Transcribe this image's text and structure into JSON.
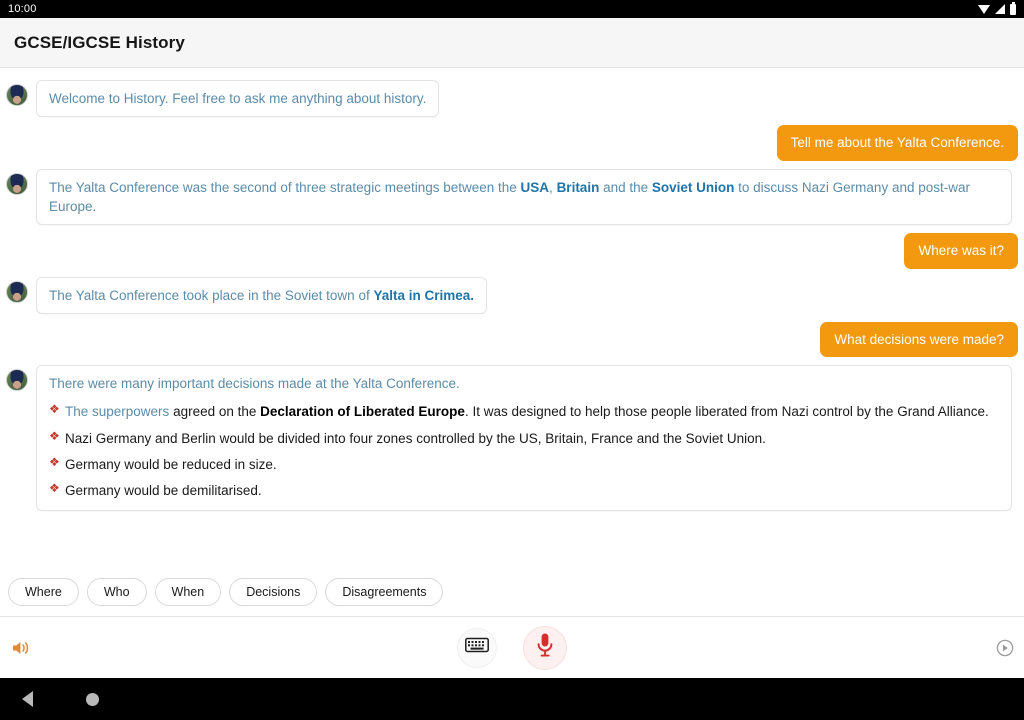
{
  "statusbar": {
    "time": "10:00",
    "icons": [
      "wifi-icon",
      "signal-icon",
      "battery-icon"
    ]
  },
  "header": {
    "title": "GCSE/IGCSE History"
  },
  "colors": {
    "user_bubble": "#f2990f",
    "bot_text": "#5b8caa",
    "bot_bold": "#1f74a8",
    "bullet": "#c0392b",
    "mic": "#d32f2f",
    "speaker": "#e08a3c"
  },
  "conversation": [
    {
      "role": "bot",
      "width": "auto",
      "text": "Welcome to History. Feel free to ask me anything about history."
    },
    {
      "role": "user",
      "text": "Tell me about the Yalta Conference."
    },
    {
      "role": "bot",
      "width": "full",
      "rich": true,
      "segments": [
        {
          "text": "The Yalta Conference was the second of three strategic meetings between the ",
          "bold": false
        },
        {
          "text": "USA",
          "bold": true
        },
        {
          "text": ", ",
          "bold": false
        },
        {
          "text": "Britain",
          "bold": true
        },
        {
          "text": " and the ",
          "bold": false
        },
        {
          "text": "Soviet Union",
          "bold": true
        },
        {
          "text": " to discuss Nazi Germany and post-war Europe.",
          "bold": false
        }
      ]
    },
    {
      "role": "user",
      "text": "Where was it?"
    },
    {
      "role": "bot",
      "width": "auto",
      "rich": true,
      "segments": [
        {
          "text": "The Yalta Conference took place in the Soviet town of ",
          "bold": false
        },
        {
          "text": "Yalta in Crimea.",
          "bold": true
        }
      ]
    },
    {
      "role": "user",
      "text": "What decisions were made?"
    }
  ],
  "decisions_card": {
    "intro": "There were many important decisions made at the Yalta Conference.",
    "bullet_glyph": "❖",
    "items": [
      {
        "segments": [
          {
            "text": "The superpowers",
            "style": "highlight"
          },
          {
            "text": " agreed on the ",
            "style": "normal"
          },
          {
            "text": "Declaration of Liberated Europe",
            "style": "bold"
          },
          {
            "text": ". It was designed to help those people liberated from Nazi control by the Grand Alliance.",
            "style": "normal"
          }
        ]
      },
      {
        "segments": [
          {
            "text": "Nazi Germany and Berlin would be divided into four zones controlled by the US, Britain, France and the Soviet Union.",
            "style": "normal"
          }
        ]
      },
      {
        "segments": [
          {
            "text": "Germany would be reduced in size.",
            "style": "normal"
          }
        ]
      },
      {
        "segments": [
          {
            "text": "Germany would be demilitarised.",
            "style": "normal"
          }
        ]
      }
    ]
  },
  "chips": [
    {
      "label": "Where"
    },
    {
      "label": "Who"
    },
    {
      "label": "When"
    },
    {
      "label": "Decisions"
    },
    {
      "label": "Disagreements"
    }
  ],
  "controlbar": {
    "speaker_icon": "speaker-icon",
    "keyboard_icon": "keyboard-icon",
    "mic_icon": "microphone-icon",
    "help_icon": "help-circle-icon"
  },
  "navbar": {
    "back_icon": "back-triangle-icon",
    "home_icon": "home-circle-icon"
  }
}
